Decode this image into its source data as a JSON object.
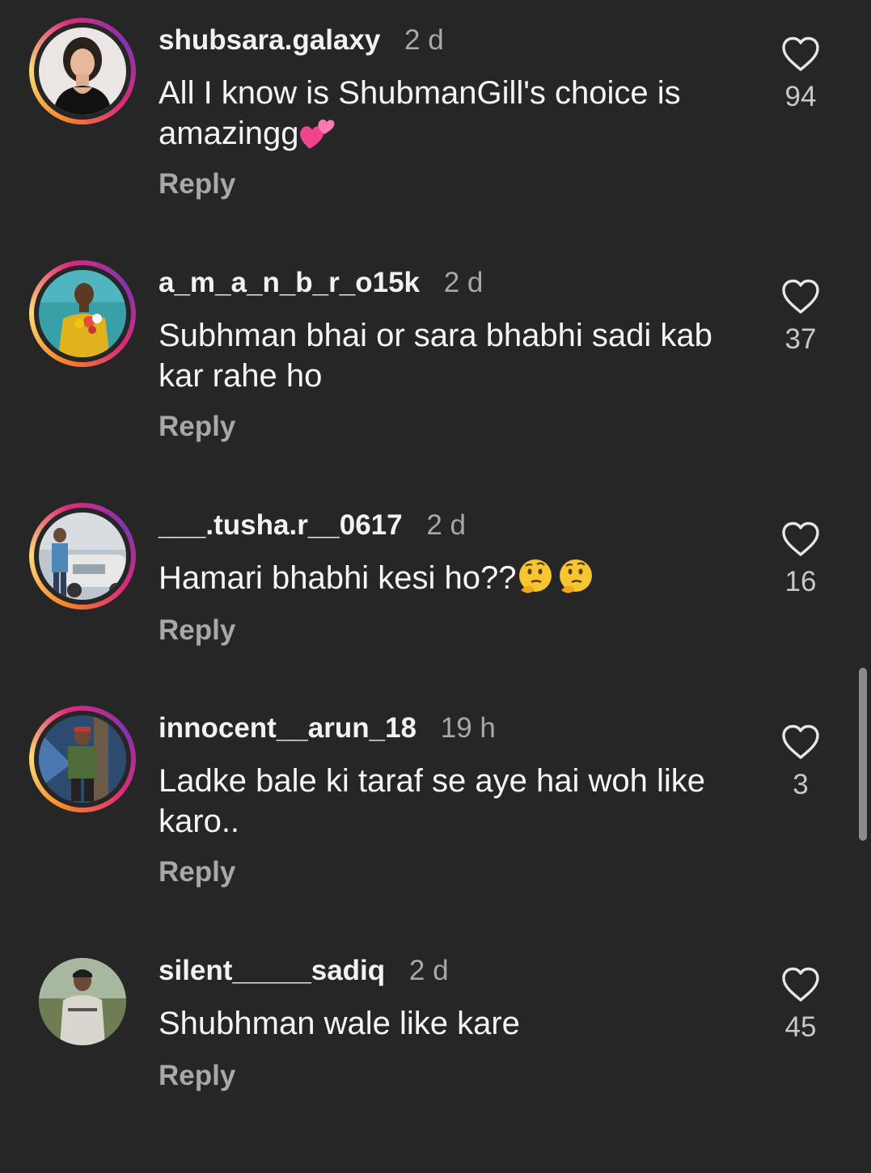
{
  "comments": [
    {
      "username": "shubsara.galaxy",
      "time": "2 d",
      "text": "All I know is ShubmanGill's choice is amazingg",
      "emoji": "two-hearts",
      "reply": "Reply",
      "likes": "94",
      "has_story_ring": true
    },
    {
      "username": "a_m_a_n_b_r_o15k",
      "time": "2 d",
      "text": "Subhman bhai or sara bhabhi sadi kab kar rahe ho",
      "emoji": "",
      "reply": "Reply",
      "likes": "37",
      "has_story_ring": true
    },
    {
      "username": "___.tusha.r__0617",
      "time": "2 d",
      "text": "Hamari bhabhi kesi ho??",
      "emoji": "thinking-face x2",
      "reply": "Reply",
      "likes": "16",
      "has_story_ring": true
    },
    {
      "username": "innocent__arun_18",
      "time": "19 h",
      "text": "Ladke bale ki taraf se aye hai woh like karo..",
      "emoji": "",
      "reply": "Reply",
      "likes": "3",
      "has_story_ring": true
    },
    {
      "username": "silent_____sadiq",
      "time": "2 d",
      "text": "Shubhman wale like kare",
      "emoji": "",
      "reply": "Reply",
      "likes": "45",
      "has_story_ring": false
    }
  ],
  "colors": {
    "background": "#262626",
    "text": "#f5f5f5",
    "muted": "#a8a8a8",
    "ring_start": "#f58529",
    "ring_end": "#dd2a7b"
  },
  "icons": {
    "like": "heart-outline-icon"
  }
}
